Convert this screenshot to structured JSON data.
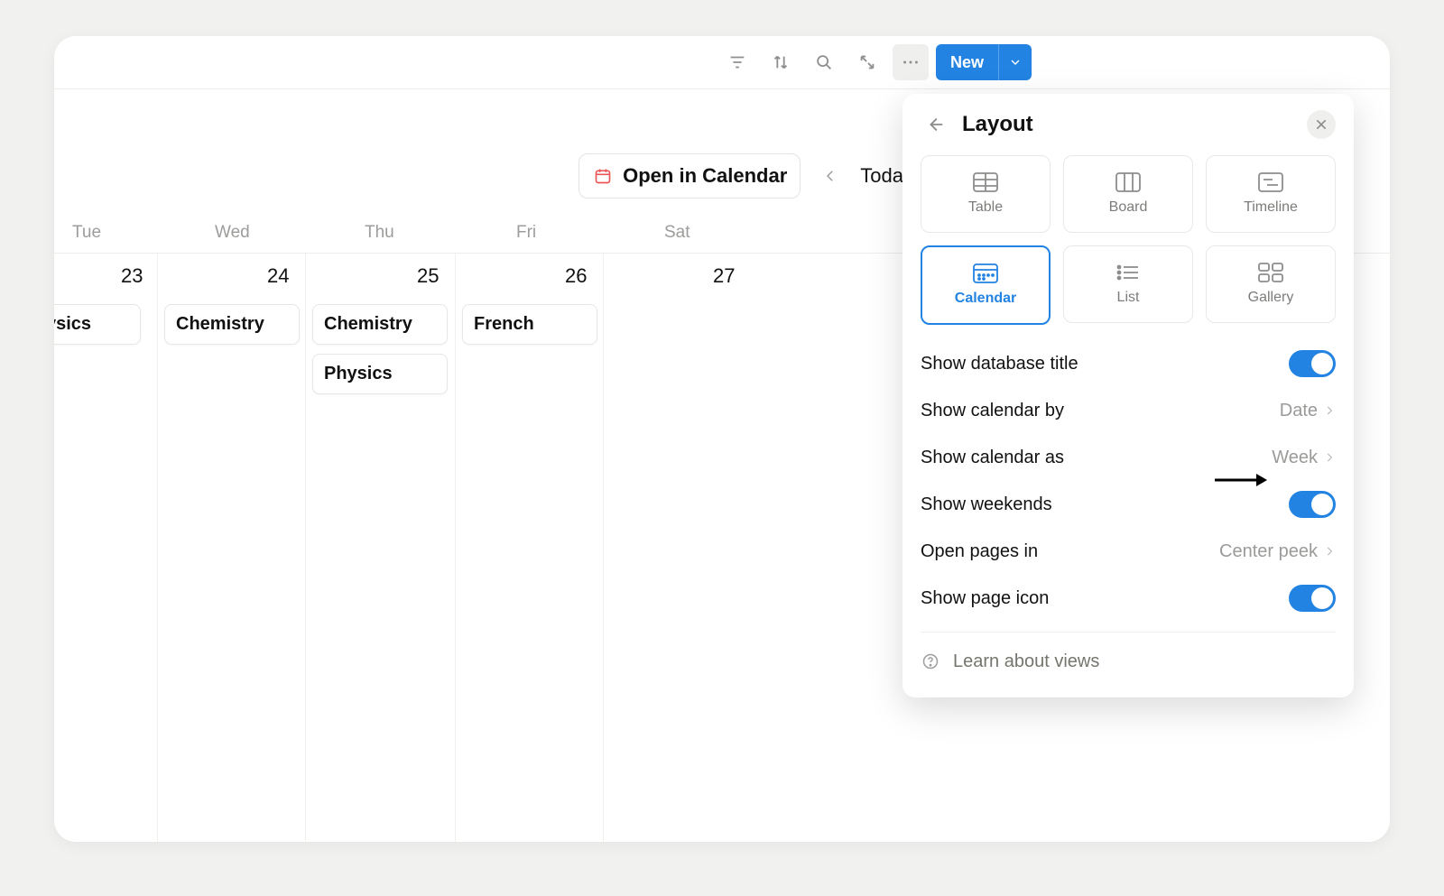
{
  "toolbar": {
    "new_label": "New"
  },
  "calendar": {
    "open_in_calendar": "Open in Calendar",
    "today": "Today",
    "days": {
      "tue": "Tue",
      "wed": "Wed",
      "thu": "Thu",
      "fri": "Fri",
      "sat": "Sat"
    },
    "dates": {
      "tue": "23",
      "wed": "24",
      "thu": "25",
      "fri": "26",
      "sat": "27"
    },
    "events": {
      "tue": [
        "ysics"
      ],
      "wed": [
        "Chemistry"
      ],
      "thu": [
        "Chemistry",
        "Physics"
      ],
      "fri": [
        "French"
      ],
      "sat": []
    }
  },
  "popover": {
    "title": "Layout",
    "views": {
      "table": "Table",
      "board": "Board",
      "timeline": "Timeline",
      "calendar": "Calendar",
      "list": "List",
      "gallery": "Gallery"
    },
    "opts": {
      "show_db_title": "Show database title",
      "show_cal_by": "Show calendar by",
      "show_cal_by_val": "Date",
      "show_cal_as": "Show calendar as",
      "show_cal_as_val": "Week",
      "show_weekends": "Show weekends",
      "open_pages_in": "Open pages in",
      "open_pages_in_val": "Center peek",
      "show_page_icon": "Show page icon"
    },
    "learn": "Learn about views"
  }
}
